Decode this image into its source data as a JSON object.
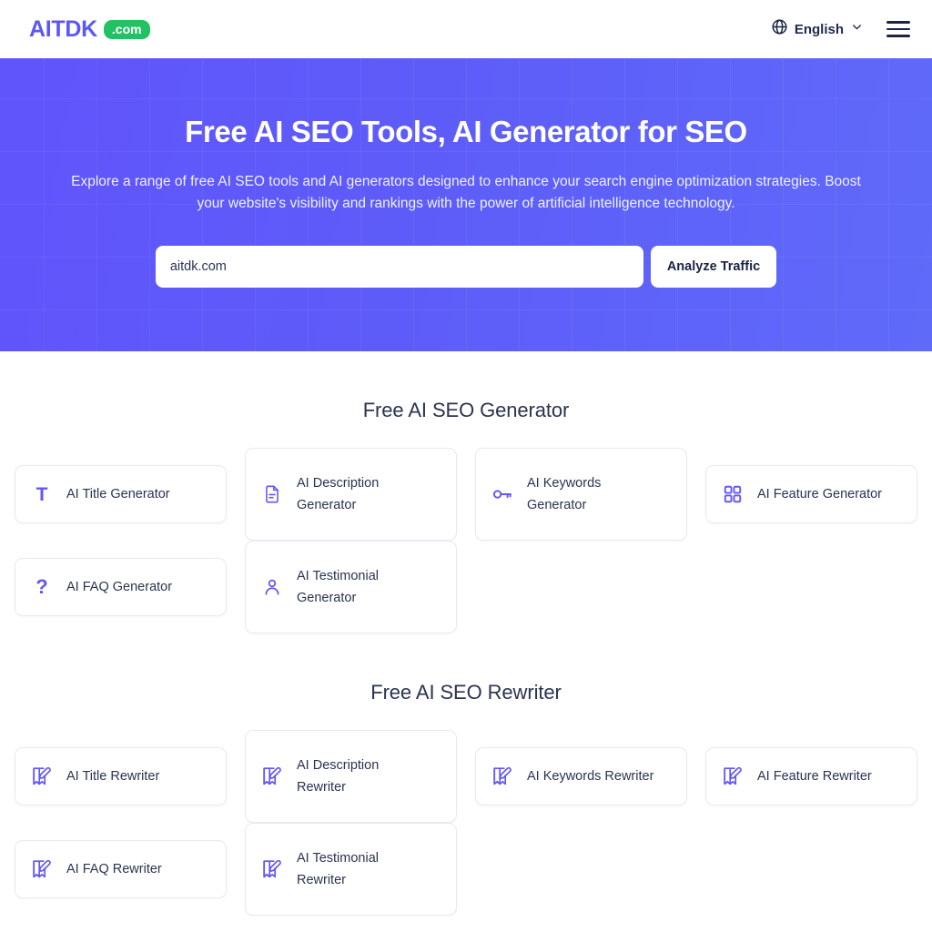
{
  "header": {
    "logo_word": "AITDK",
    "logo_badge": ".com",
    "language": "English",
    "globe_icon": "globe-icon",
    "chevron_icon": "chevron-down-icon",
    "menu_icon": "hamburger-menu-icon"
  },
  "hero": {
    "title": "Free AI SEO Tools, AI Generator for SEO",
    "subtitle": "Explore a range of free AI SEO tools and AI generators designed to enhance your search engine optimization strategies. Boost your website's visibility and rankings with the power of artificial intelligence technology.",
    "input_value": "aitdk.com",
    "input_placeholder": "aitdk.com",
    "button_label": "Analyze Traffic",
    "gradient_from": "#6054fb",
    "gradient_to": "#5f6af9"
  },
  "generator_section": {
    "title": "Free AI SEO Generator",
    "cards": [
      {
        "label": "AI Title Generator",
        "icon": "text-t-icon",
        "wrap": false
      },
      {
        "label": "AI Description Generator",
        "icon": "document-icon",
        "wrap": true
      },
      {
        "label": "AI Keywords Generator",
        "icon": "key-icon",
        "wrap": true
      },
      {
        "label": "AI Feature Generator",
        "icon": "grid-squares-icon",
        "wrap": false
      },
      {
        "label": "AI FAQ Generator",
        "icon": "question-mark-icon",
        "wrap": false
      },
      {
        "label": "AI Testimonial Generator",
        "icon": "person-icon",
        "wrap": true
      }
    ]
  },
  "rewriter_section": {
    "title": "Free AI SEO Rewriter",
    "cards": [
      {
        "label": "AI Title Rewriter",
        "icon": "edit-pencil-icon",
        "wrap": false
      },
      {
        "label": "AI Description Rewriter",
        "icon": "edit-pencil-icon",
        "wrap": true
      },
      {
        "label": "AI Keywords Rewriter",
        "icon": "edit-pencil-icon",
        "wrap": false
      },
      {
        "label": "AI Feature Rewriter",
        "icon": "edit-pencil-icon",
        "wrap": false
      },
      {
        "label": "AI FAQ Rewriter",
        "icon": "edit-pencil-icon",
        "wrap": false
      },
      {
        "label": "AI Testimonial Rewriter",
        "icon": "edit-pencil-icon",
        "wrap": true
      }
    ]
  },
  "theme": {
    "accent": "#6257f5",
    "logo_purple": "#5c58f6",
    "badge_green": "#22c264",
    "text_dark": "#2b3350",
    "card_border": "#e7eaf2"
  }
}
